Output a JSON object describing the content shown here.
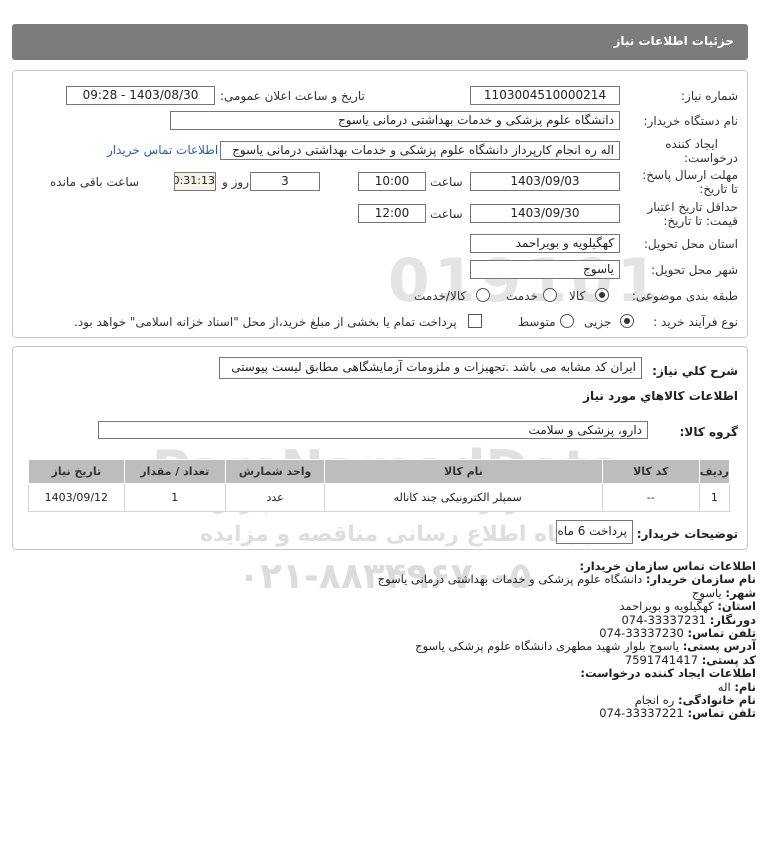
{
  "header": {
    "title": "جزئیات اطلاعات نیاز"
  },
  "form": {
    "need_no_label": "شماره نیاز:",
    "need_no": "1103004510000214",
    "announce_label": "تاریخ و ساعت اعلان عمومی:",
    "announce_value": "1403/08/30 - 09:28",
    "buyer_label": "نام دستگاه خریدار:",
    "buyer_value": "دانشگاه علوم پزشکی و خدمات بهداشتی  درمانی یاسوج",
    "creator_label1": "ایجاد کننده",
    "creator_label2": "درخواست:",
    "creator_value": "اله ره انجام کارپرداز دانشگاه علوم پزشکی و خدمات بهداشتی  درمانی یاسوج",
    "contact_link": "اطلاعات تماس خریدار",
    "deadline_label1": "مهلت ارسال پاسخ:",
    "deadline_label2": "تا تاریخ:",
    "deadline_date": "1403/09/03",
    "time_label": "ساعت",
    "deadline_time": "10:00",
    "days_value": "3",
    "days_label": "روز و",
    "remaining_value": "00:31:13",
    "remaining_label": "ساعت باقی مانده",
    "validity_label1": "حداقل تاریخ اعتبار",
    "validity_label2": "قیمت: تا تاریخ:",
    "validity_date": "1403/09/30",
    "validity_time": "12:00",
    "province_label": "استان محل تحویل:",
    "province_value": "کهگیلویه و بویراحمد",
    "city_label": "شهر محل تحویل:",
    "city_value": "یاسوج",
    "category_label": "طبقه بندی موضوعی:",
    "category_options": [
      "کالا",
      "خدمت",
      "کالا/خدمت"
    ],
    "category_selected": "کالا",
    "process_label": "نوع فرآیند خرید :",
    "process_options": [
      "جزیی",
      "متوسط"
    ],
    "process_selected": "جزیی",
    "payment_note": "پرداخت تمام یا بخشی از مبلغ خرید،از محل \"اسناد خزانه اسلامی\" خواهد بود."
  },
  "summary": {
    "label": "شرح کلي نياز:",
    "value": "ایران کد مشابه می باشد .تجهیزات و ملزومات آزمایشگاهی مطابق لیست پیوستی"
  },
  "goods": {
    "section_title": "اطلاعات کالاهاي مورد نياز",
    "group_label": "گروه کالا:",
    "group_value": "دارو، پزشکی و سلامت",
    "columns": [
      "ردیف",
      "کد کالا",
      "نام کالا",
      "واحد شمارش",
      "تعداد / مقدار",
      "تاریخ نیاز"
    ],
    "rows": [
      [
        "1",
        "--",
        "سمپلر الکترونیکی چند کاناله",
        "عدد",
        "1",
        "1403/09/12"
      ]
    ],
    "notes_label": "توضیحات خریدار:",
    "notes_value": "پرداخت 6 ماه"
  },
  "contact": {
    "title": "اطلاعات تماس سازمان خریدار:",
    "lines": [
      {
        "k": "نام سازمان خریدار:",
        "v": "دانشگاه علوم پزشکی و خدمات بهداشتی درمانی یاسوج"
      },
      {
        "k": "شهر:",
        "v": "یاسوج"
      },
      {
        "k": "استان:",
        "v": "کهگیلویه و بویراحمد"
      },
      {
        "k": "دورنگار:",
        "v": "074-33337231"
      },
      {
        "k": "تلفن تماس:",
        "v": "074-33337230"
      },
      {
        "k": "آدرس پستی:",
        "v": "یاسوج بلوار شهید مطهری دانشگاه علوم پزشکی یاسوج"
      },
      {
        "k": "کد پستی:",
        "v": "7591741417"
      }
    ],
    "creator_title": "اطلاعات ایجاد کننده درخواست:",
    "creator_lines": [
      {
        "k": "نام:",
        "v": "اله"
      },
      {
        "k": "نام خانوادگی:",
        "v": "ره انجام"
      },
      {
        "k": "تلفن تماس:",
        "v": "074-33337221"
      }
    ]
  },
  "watermark": {
    "number": "019101",
    "brand": "ParsNamadData",
    "line1": "مرکز اطلاعات مناقصات پارس",
    "line2": "پایگاه اطلاع رسانی مناقصه و مزایده",
    "phone": "۰۲۱-۸۸۳۴۹۶۷۰-۵"
  }
}
